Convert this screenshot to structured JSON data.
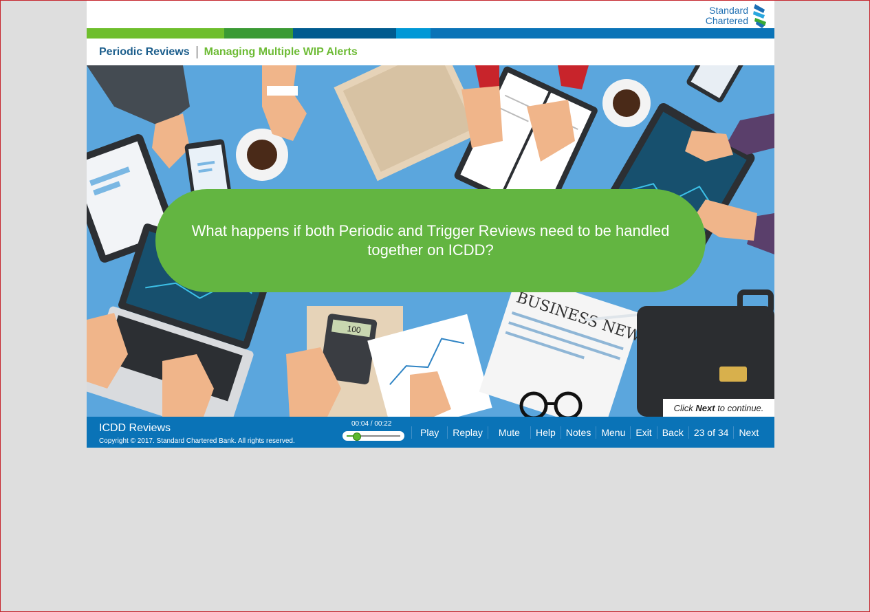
{
  "logo": {
    "line1": "Standard",
    "line2": "Chartered"
  },
  "stripe_colors": [
    "#6ebe2c",
    "#3a9a34",
    "#005b8f",
    "#0098d6",
    "#0a73b7"
  ],
  "breadcrumb": {
    "module": "Periodic Reviews",
    "topic": "Managing Multiple WIP Alerts"
  },
  "stage": {
    "question": "What happens if both Periodic and Trigger Reviews need to be handled together on ICDD?",
    "continue_prefix": "Click ",
    "continue_bold": "Next",
    "continue_suffix": " to continue.",
    "calculator_display": "100",
    "newspaper_headline": "BUSINESS NEWS"
  },
  "footer": {
    "course_title": "ICDD Reviews",
    "copyright": "Copyright © 2017. Standard Chartered Bank. All rights reserved.",
    "time": "00:04 / 00:22",
    "progress_fraction": 0.18,
    "nav": {
      "play": "Play",
      "replay": "Replay",
      "mute": "Mute",
      "help": "Help",
      "notes": "Notes",
      "menu": "Menu",
      "exit": "Exit",
      "back": "Back",
      "page": "23 of 34",
      "next": "Next"
    }
  }
}
